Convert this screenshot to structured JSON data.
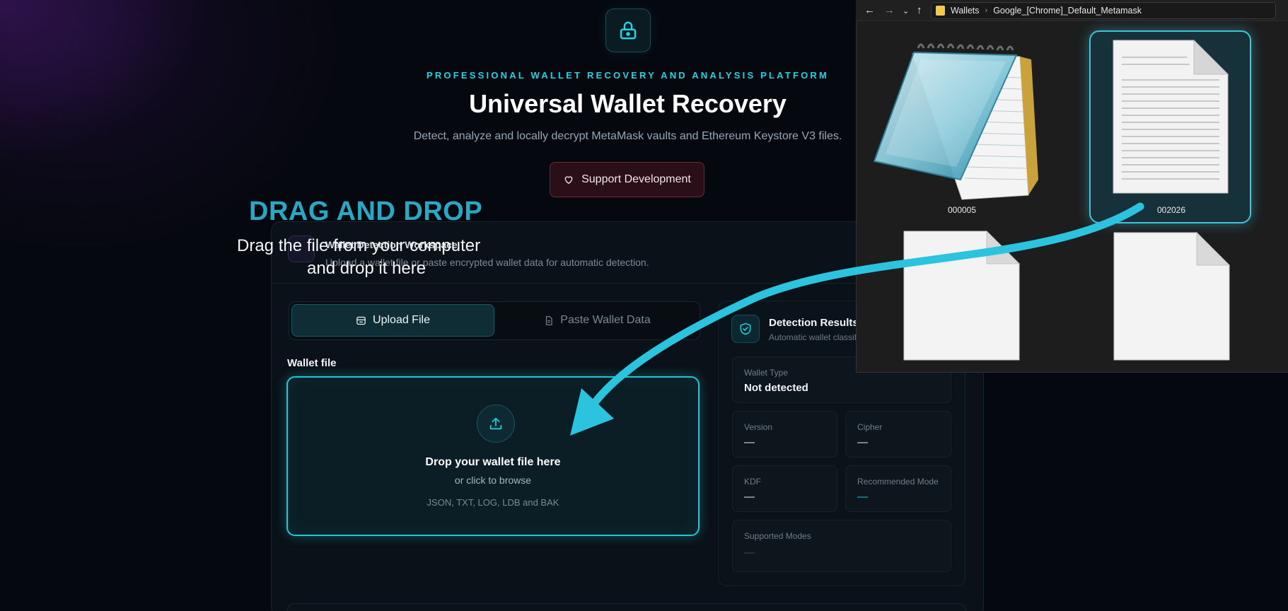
{
  "header": {
    "kicker": "PROFESSIONAL WALLET RECOVERY AND ANALYSIS PLATFORM",
    "title": "Universal Wallet Recovery",
    "subtitle": "Detect, analyze and locally decrypt MetaMask vaults and Ethereum Keystore V3 files.",
    "support_label": "Support Development"
  },
  "card": {
    "title": "Wallet Detection Workspace",
    "subtitle": "Upload a wallet file or paste encrypted wallet data for automatic detection."
  },
  "tabs": [
    {
      "label": "Upload File",
      "active": true
    },
    {
      "label": "Paste Wallet Data",
      "active": false
    }
  ],
  "upload": {
    "field_label": "Wallet file",
    "drop_title": "Drop your wallet file here",
    "drop_browse": "or click to browse",
    "formats": "JSON, TXT, LOG, LDB and BAK"
  },
  "results": {
    "title": "Detection Results",
    "subtitle": "Automatic wallet classification",
    "wallet_type": {
      "label": "Wallet Type",
      "value": "Not detected"
    },
    "version": {
      "label": "Version",
      "value": "—"
    },
    "cipher": {
      "label": "Cipher",
      "value": "—"
    },
    "kdf": {
      "label": "KDF",
      "value": "—"
    },
    "recommended_mode": {
      "label": "Recommended Mode",
      "value": "—"
    },
    "supported_modes": {
      "label": "Supported Modes",
      "value": "—"
    }
  },
  "overlay": {
    "title": "DRAG AND DROP",
    "line1": "Drag the file from your computer",
    "line2": "and drop it here"
  },
  "explorer": {
    "breadcrumb": [
      "Wallets",
      "Google_[Chrome]_Default_Metamask"
    ],
    "files": [
      {
        "name": "000005",
        "icon": "notepad-icon"
      },
      {
        "name": "002026",
        "icon": "text-document-icon",
        "selected": true
      },
      {
        "name": "",
        "icon": "blank-file-icon"
      },
      {
        "name": "",
        "icon": "blank-file-icon"
      }
    ]
  },
  "colors": {
    "accent": "#22c6d4",
    "kicker": "#22d3e0",
    "support_border": "#6e2838",
    "background": "#06080f",
    "arrow": "#2cc3de"
  }
}
